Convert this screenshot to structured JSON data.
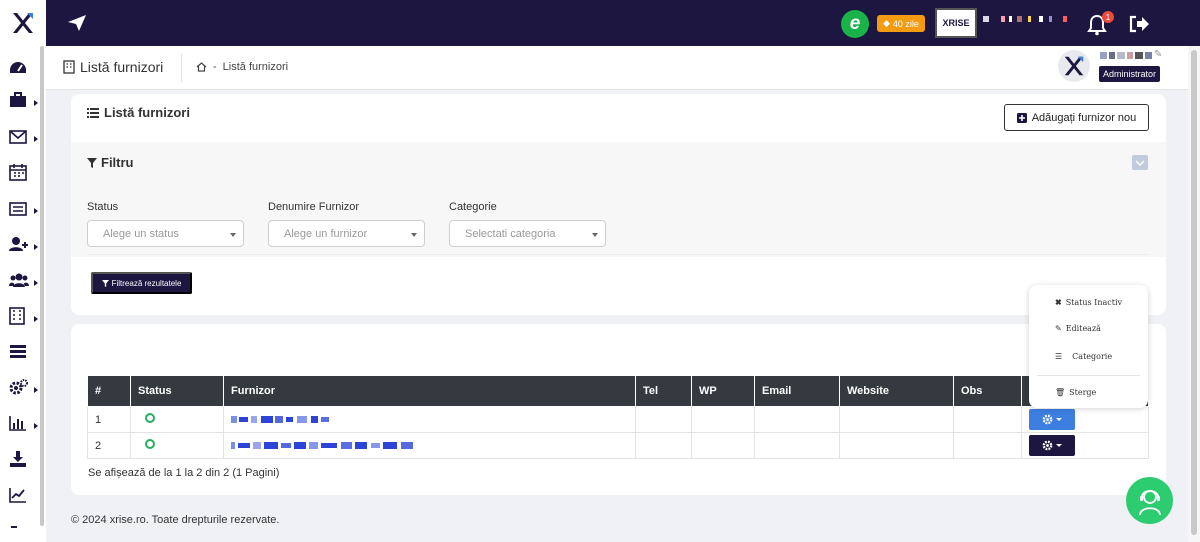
{
  "topbar": {
    "trial_badge": "40 zile",
    "company_logo_text": "XRISE",
    "notification_count": "1",
    "e_logo": "e"
  },
  "header": {
    "title": "Listă furnizori",
    "breadcrumb_separator": "-",
    "breadcrumb_current": "Listă furnizori",
    "user_role": "Administrator"
  },
  "card": {
    "title": "Listă furnizori",
    "add_button": "Adăugați furnizor nou"
  },
  "filter": {
    "title": "Filtru",
    "fields": [
      {
        "label": "Status",
        "placeholder": "Alege un status"
      },
      {
        "label": "Denumire Furnizor",
        "placeholder": "Alege un furnizor"
      },
      {
        "label": "Categorie",
        "placeholder": "Selectati categoria"
      }
    ],
    "submit_button": "Filtrează rezultatele"
  },
  "table": {
    "columns": [
      "#",
      "Status",
      "Furnizor",
      "Tel",
      "WP",
      "Email",
      "Website",
      "Obs",
      ""
    ],
    "rows": [
      {
        "index": "1",
        "tel": "",
        "wp": "",
        "email": "",
        "website": "",
        "obs": ""
      },
      {
        "index": "2",
        "tel": "",
        "wp": "",
        "email": "",
        "website": "",
        "obs": ""
      }
    ],
    "pagination_text": "Se afișează de la 1 la 2 din 2 (1 Pagini)"
  },
  "dropdown": {
    "items": [
      "Status Inactiv",
      "Editează",
      "Categorie",
      "Sterge"
    ]
  },
  "footer": {
    "text": "© 2024 xrise.ro. Toate drepturile rezervate."
  },
  "colors": {
    "navy": "#1c1640",
    "accent_blue": "#3d7fe0",
    "success_green": "#27ae60",
    "badge_orange": "#f39c12",
    "table_header": "#343a40"
  }
}
